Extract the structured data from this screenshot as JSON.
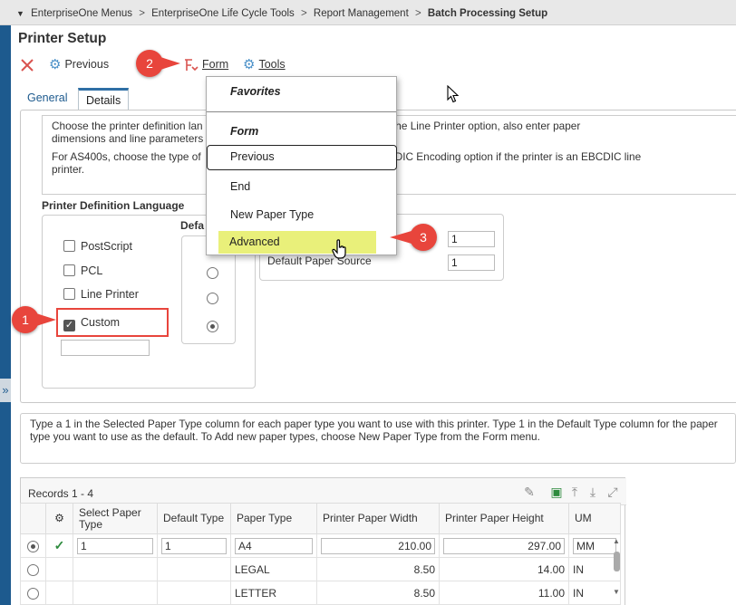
{
  "breadcrumb": [
    "EnterpriseOne Menus",
    "EnterpriseOne Life Cycle Tools",
    "Report Management",
    "Batch Processing Setup"
  ],
  "page_title": "Printer Setup",
  "toolbar": {
    "previous_label": "Previous",
    "form_label": "Form",
    "tools_label": "Tools"
  },
  "tabs": [
    "General",
    "Details"
  ],
  "details_description": {
    "line1": "Choose the printer definition lan",
    "line1_tail": "If you choose the Line Printer option, also enter paper",
    "line2": "dimensions and line parameters",
    "line3": "For AS400s, choose the type of",
    "line3_tail": "e EBCDIC Encoding option if the printer is an EBCDIC line",
    "line4": "printer."
  },
  "pdl": {
    "label": "Printer Definition Language",
    "options": [
      {
        "label": "PostScript",
        "checked": false
      },
      {
        "label": "PCL",
        "checked": false
      },
      {
        "label": "Line Printer",
        "checked": false
      },
      {
        "label": "Custom",
        "checked": true
      }
    ]
  },
  "default_label": "Defa",
  "paper": {
    "source_label": "Default Paper Source",
    "value1": "1",
    "value2": "1"
  },
  "menu": {
    "favorites_header": "Favorites",
    "form_header": "Form",
    "items": [
      "Previous",
      "End",
      "New Paper Type",
      "Advanced"
    ]
  },
  "callouts": [
    "1",
    "2",
    "3"
  ],
  "help_text": "Type a 1 in the Selected Paper Type column for each paper type you want to use with this printer. Type 1 in the Default Type column for the paper type you want to use as the default. To Add new paper types, choose New Paper Type from the Form menu.",
  "grid": {
    "records": "Records 1 - 4",
    "columns": [
      "Select Paper Type",
      "Default Type",
      "Paper Type",
      "Printer Paper Width",
      "Printer Paper Height",
      "UM"
    ],
    "rows": [
      {
        "select": "1",
        "default": "1",
        "paper_type": "A4",
        "width": "210.00",
        "height": "297.00",
        "um": "MM",
        "selected": true
      },
      {
        "select": "",
        "default": "",
        "paper_type": "LEGAL",
        "width": "8.50",
        "height": "14.00",
        "um": "IN",
        "selected": false
      },
      {
        "select": "",
        "default": "",
        "paper_type": "LETTER",
        "width": "8.50",
        "height": "11.00",
        "um": "IN",
        "selected": false
      }
    ]
  },
  "colors": {
    "accent": "#1d5a8e",
    "callout": "#e8453c",
    "highlight": "#e9f07a"
  }
}
